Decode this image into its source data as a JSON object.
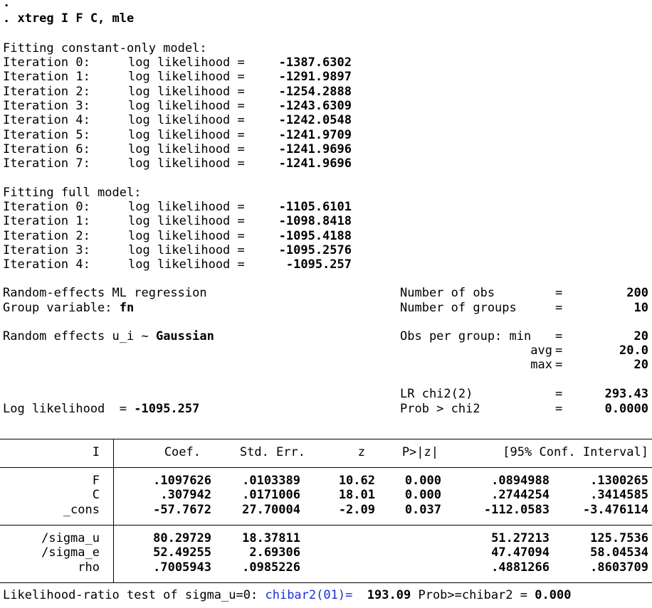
{
  "prompt_dot": ".",
  "command": ". xtreg I F C, mle",
  "constant_only": {
    "heading": "Fitting constant-only model:",
    "iterations": [
      {
        "label": "Iteration 0:",
        "text": "log likelihood =",
        "value": "-1387.6302"
      },
      {
        "label": "Iteration 1:",
        "text": "log likelihood =",
        "value": "-1291.9897"
      },
      {
        "label": "Iteration 2:",
        "text": "log likelihood =",
        "value": "-1254.2888"
      },
      {
        "label": "Iteration 3:",
        "text": "log likelihood =",
        "value": "-1243.6309"
      },
      {
        "label": "Iteration 4:",
        "text": "log likelihood =",
        "value": "-1242.0548"
      },
      {
        "label": "Iteration 5:",
        "text": "log likelihood =",
        "value": "-1241.9709"
      },
      {
        "label": "Iteration 6:",
        "text": "log likelihood =",
        "value": "-1241.9696"
      },
      {
        "label": "Iteration 7:",
        "text": "log likelihood =",
        "value": "-1241.9696"
      }
    ]
  },
  "full_model": {
    "heading": "Fitting full model:",
    "iterations": [
      {
        "label": "Iteration 0:",
        "text": "log likelihood =",
        "value": "-1105.6101"
      },
      {
        "label": "Iteration 1:",
        "text": "log likelihood =",
        "value": "-1098.8418"
      },
      {
        "label": "Iteration 2:",
        "text": "log likelihood =",
        "value": "-1095.4188"
      },
      {
        "label": "Iteration 3:",
        "text": "log likelihood =",
        "value": "-1095.2576"
      },
      {
        "label": "Iteration 4:",
        "text": "log likelihood =",
        "value": "-1095.257"
      }
    ]
  },
  "header": {
    "model": "Random-effects ML regression",
    "group_label": "Group variable:",
    "group_value": "fn",
    "re_label": "Random effects u_i ~",
    "re_value": "Gaussian",
    "loglik_label": "Log likelihood  =",
    "loglik_value": "-1095.257",
    "stats": [
      {
        "label": "Number of obs",
        "eq": "=",
        "value": "200"
      },
      {
        "label": "Number of groups",
        "eq": "=",
        "value": "10"
      },
      {
        "label": "Obs per group: min",
        "eq": "=",
        "value": "20"
      },
      {
        "label": "avg",
        "eq": "=",
        "value": "20.0"
      },
      {
        "label": "max",
        "eq": "=",
        "value": "20"
      },
      {
        "label": "LR chi2(2)",
        "eq": "=",
        "value": "293.43"
      },
      {
        "label": "Prob > chi2",
        "eq": "=",
        "value": "0.0000"
      }
    ]
  },
  "table": {
    "columns": [
      "I",
      "Coef.",
      "Std. Err.",
      "z",
      "P>|z|",
      "[95% Conf. Interval]"
    ],
    "rows": [
      {
        "name": "F",
        "coef": ".1097626",
        "se": ".0103389",
        "z": "10.62",
        "p": "0.000",
        "lo": ".0894988",
        "hi": ".1300265"
      },
      {
        "name": "C",
        "coef": ".307942",
        "se": ".0171006",
        "z": "18.01",
        "p": "0.000",
        "lo": ".2744254",
        "hi": ".3414585"
      },
      {
        "name": "_cons",
        "coef": "-57.7672",
        "se": "27.70004",
        "z": "-2.09",
        "p": "0.037",
        "lo": "-112.0583",
        "hi": "-3.476114"
      }
    ],
    "variance_rows": [
      {
        "name": "/sigma_u",
        "coef": "80.29729",
        "se": "18.37811",
        "lo": "51.27213",
        "hi": "125.7536"
      },
      {
        "name": "/sigma_e",
        "coef": "52.49255",
        "se": "2.69306",
        "lo": "47.47094",
        "hi": "58.04534"
      },
      {
        "name": "rho",
        "coef": ".7005943",
        "se": ".0985226",
        "lo": ".4881266",
        "hi": ".8603709"
      }
    ]
  },
  "footer": {
    "label": "Likelihood-ratio test of sigma_u=0:",
    "chibar_label": "chibar2(01)=",
    "chibar_value": "193.09",
    "prob_label": "Prob>=chibar2 =",
    "prob_value": "0.000"
  }
}
